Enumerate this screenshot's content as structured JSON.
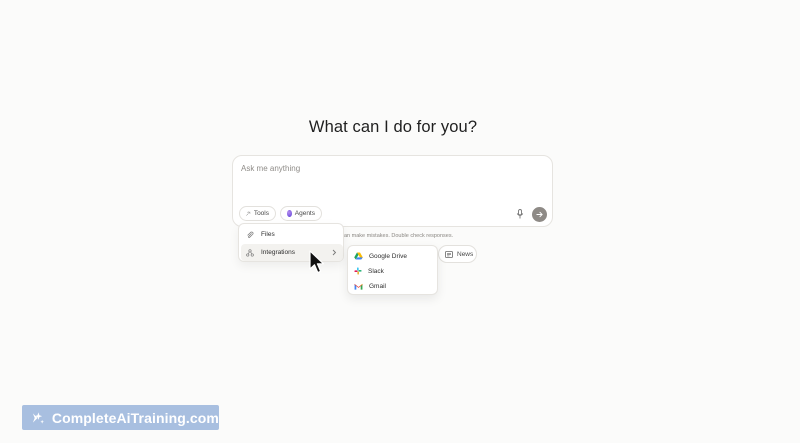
{
  "heading": "What can I do for you?",
  "composer": {
    "placeholder": "Ask me anything",
    "tools_label": "Tools",
    "agents_label": "Agents",
    "icons": {
      "tools": "tools-icon",
      "mic": "microphone-icon",
      "send": "arrow-right-icon"
    }
  },
  "disclaimer": "an make mistakes. Double check responses.",
  "suggestion": {
    "news_label": "News",
    "icon": "newspaper-icon"
  },
  "tools_menu": {
    "items": [
      {
        "label": "Files",
        "icon": "paperclip-icon"
      },
      {
        "label": "Integrations",
        "icon": "integrations-icon"
      }
    ]
  },
  "integrations_menu": {
    "items": [
      {
        "label": "Google Drive",
        "icon": "google-drive-icon"
      },
      {
        "label": "Slack",
        "icon": "slack-icon"
      },
      {
        "label": "Gmail",
        "icon": "gmail-icon"
      }
    ]
  },
  "watermark": {
    "text": "CompleteAiTraining.com"
  },
  "colors": {
    "send_button": "#8e8a86",
    "menu_hover": "#f3f2ef",
    "watermark_bg": "#a8bfe0"
  }
}
